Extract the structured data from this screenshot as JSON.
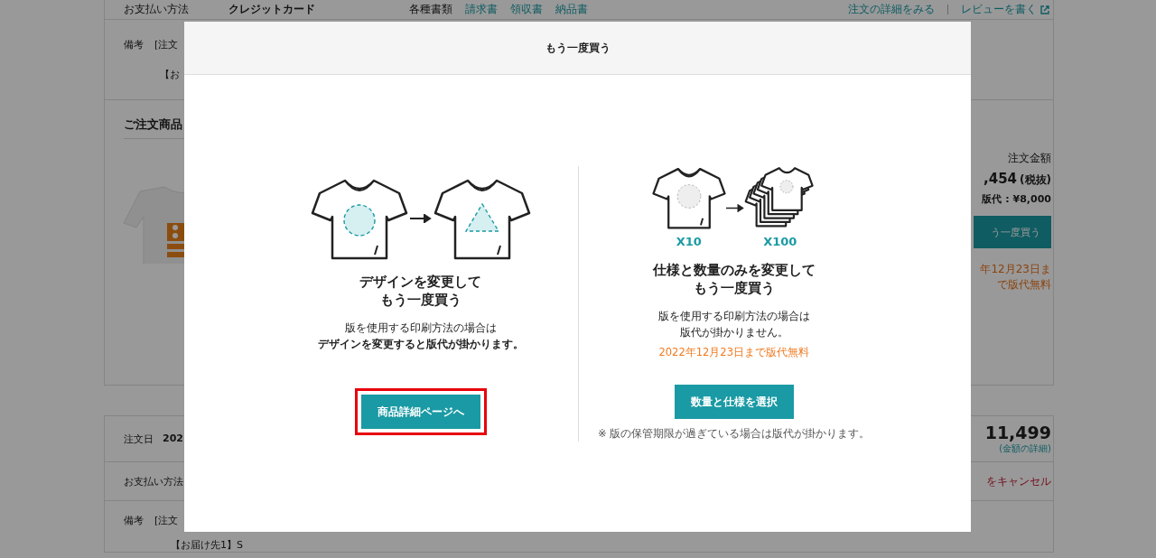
{
  "background": {
    "top_row": {
      "payment_label": "お支払い方法",
      "payment_value": "クレジットカード",
      "documents_label": "各種書類",
      "document_links": [
        "請求書",
        "領収書",
        "納品書"
      ],
      "order_detail_link": "注文の詳細をみる",
      "review_link": "レビューを書く"
    },
    "order1": {
      "memo_label": "備考",
      "memo_value": "[注文",
      "address": "【お",
      "items_heading": "ご注文商品",
      "amount_label": "注文金額",
      "amount": ",454",
      "tax_note": "(税抜)",
      "plate_fee": "版代 : ¥8,000",
      "buy_again_button": "う一度買う",
      "free_note_lines": [
        "年12月23日ま",
        "で版代無料"
      ]
    },
    "order2": {
      "date_label": "注文日",
      "date_value": "202",
      "total": "11,499",
      "total_detail_link": "(金額の詳細)",
      "payment_label": "お支払い方法",
      "cancel_link": "をキャンセル",
      "memo_label": "備考",
      "memo_value": "[注文",
      "address": "【お届け先1】S"
    }
  },
  "modal": {
    "title": "もう一度買う",
    "options": [
      {
        "kind": "design",
        "heading_lines": [
          "デザインを変更して",
          "もう一度買う"
        ],
        "description_lines": [
          {
            "text": "版を使用する印刷方法の場合は",
            "bold": false
          },
          {
            "text": "デザインを変更すると版代が掛かります。",
            "bold": true
          }
        ],
        "button": "商品詳細ページへ",
        "highlighted": true
      },
      {
        "kind": "spec",
        "quantity_labels": [
          "X10",
          "X100"
        ],
        "heading_lines": [
          "仕様と数量のみを変更して",
          "もう一度買う"
        ],
        "description_lines": [
          {
            "text": "版を使用する印刷方法の場合は",
            "bold": false
          },
          {
            "text": "版代が掛かりません。",
            "bold": false
          }
        ],
        "notice": "2022年12月23日まで版代無料",
        "button": "数量と仕様を選択",
        "highlighted": false,
        "footnote": "※ 版の保管期限が過ぎている場合は版代が掛かります。"
      }
    ]
  }
}
